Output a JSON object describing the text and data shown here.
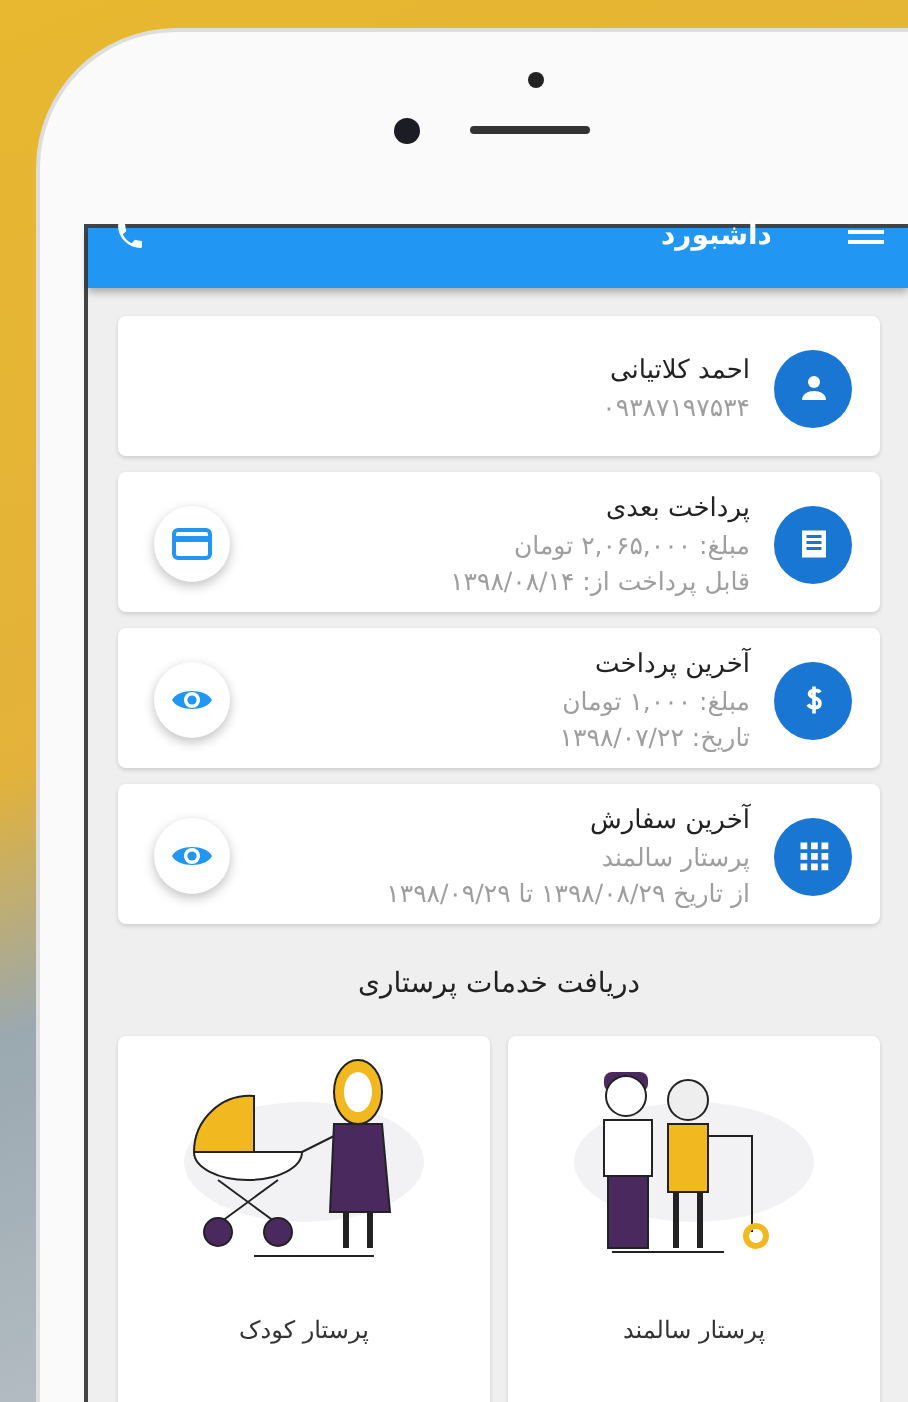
{
  "app_bar": {
    "title": "داشبورد"
  },
  "cards": [
    {
      "kind": "profile",
      "title": "احمد کلاتیانی",
      "lines": [
        "۰۹۳۸۷۱۹۷۵۳۴"
      ]
    },
    {
      "kind": "bill",
      "title": "پرداخت بعدی",
      "lines": [
        "مبلغ: ۲,۰۶۵,۰۰۰ تومان",
        "قابل پرداخت از: ۱۳۹۸/۰۸/۱۴"
      ],
      "button": {
        "kind": "card"
      }
    },
    {
      "kind": "payment",
      "title": "آخرین پرداخت",
      "lines": [
        "مبلغ: ۱,۰۰۰ تومان",
        "تاریخ: ۱۳۹۸/۰۷/۲۲"
      ],
      "button": {
        "kind": "eye"
      }
    },
    {
      "kind": "order",
      "title": "آخرین سفارش",
      "lines": [
        "پرستار سالمند",
        "از تاریخ ۱۳۹۸/۰۸/۲۹ تا ۱۳۹۸/۰۹/۲۹"
      ],
      "button": {
        "kind": "eye"
      }
    }
  ],
  "services_title": "دریافت خدمات پرستاری",
  "services": [
    {
      "kind": "elderly",
      "label": "پرستار سالمند"
    },
    {
      "kind": "child",
      "label": "پرستار کودک"
    }
  ]
}
